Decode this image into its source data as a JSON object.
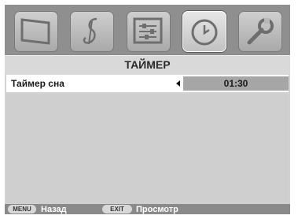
{
  "menu": {
    "tabs": [
      {
        "icon": "tv-picture-icon",
        "active": false
      },
      {
        "icon": "music-note-icon",
        "active": false
      },
      {
        "icon": "settings-sliders-icon",
        "active": false
      },
      {
        "icon": "clock-icon",
        "active": true
      },
      {
        "icon": "wrench-icon",
        "active": false
      }
    ],
    "title": "ТАЙМЕР",
    "rows": [
      {
        "label": "Таймер сна",
        "value": "01:30",
        "selected": true
      }
    ]
  },
  "footer": {
    "menu_key": "MENU",
    "menu_label": "Назад",
    "exit_key": "EXIT",
    "exit_label": "Просмотр"
  },
  "colors": {
    "panel": "#d2d2d2",
    "tabbar": "#8f8f8f",
    "value_box": "#a6a6a6",
    "footer": "#8a8a8a"
  }
}
